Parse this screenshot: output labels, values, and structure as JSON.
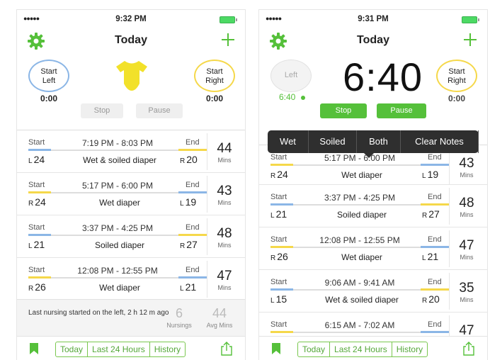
{
  "colors": {
    "accent": "#55c03a",
    "left_side": "#8bb6e6",
    "right_side": "#f5d84a",
    "onesie": "#f2e12a"
  },
  "left_screen": {
    "status": {
      "time": "9:32 PM"
    },
    "nav": {
      "title": "Today"
    },
    "start_left": {
      "label_1": "Start",
      "label_2": "Left",
      "time": "0:00"
    },
    "start_right": {
      "label_1": "Start",
      "label_2": "Right",
      "time": "0:00"
    },
    "stop_label": "Stop",
    "pause_label": "Pause",
    "entries": [
      {
        "start": "Start",
        "end": "End",
        "range": "7:19 PM - 8:03 PM",
        "a_side": "L",
        "a_val": "24",
        "desc": "Wet & soiled diaper",
        "b_side": "R",
        "b_val": "20",
        "mins": "44",
        "mins_label": "Mins"
      },
      {
        "start": "Start",
        "end": "End",
        "range": "5:17 PM - 6:00 PM",
        "a_side": "R",
        "a_val": "24",
        "desc": "Wet diaper",
        "b_side": "L",
        "b_val": "19",
        "mins": "43",
        "mins_label": "Mins"
      },
      {
        "start": "Start",
        "end": "End",
        "range": "3:37 PM - 4:25 PM",
        "a_side": "L",
        "a_val": "21",
        "desc": "Soiled diaper",
        "b_side": "R",
        "b_val": "27",
        "mins": "48",
        "mins_label": "Mins"
      },
      {
        "start": "Start",
        "end": "End",
        "range": "12:08 PM - 12:55 PM",
        "a_side": "R",
        "a_val": "26",
        "desc": "Wet diaper",
        "b_side": "L",
        "b_val": "21",
        "mins": "47",
        "mins_label": "Mins"
      }
    ],
    "summary": {
      "text": "Last nursing started on the left, 2 h 12 m ago",
      "nursings_value": "6",
      "nursings_label": "Nursings",
      "avg_value": "44",
      "avg_label": "Avg Mins"
    },
    "toolbar": {
      "today": "Today",
      "last24": "Last 24 Hours",
      "history": "History"
    }
  },
  "right_screen": {
    "status": {
      "time": "9:31 PM"
    },
    "nav": {
      "title": "Today"
    },
    "left_circle": {
      "label": "Left",
      "elapsed": "6:40"
    },
    "timer": "6:40",
    "start_right": {
      "label_1": "Start",
      "label_2": "Right",
      "time": "0:00"
    },
    "stop_label": "Stop",
    "pause_label": "Pause",
    "popover": [
      "Wet",
      "Soiled",
      "Both",
      "Clear Notes"
    ],
    "entries": [
      {
        "start": "Start",
        "end": "End",
        "range": "5:17 PM - 6:00 PM",
        "a_side": "R",
        "a_val": "24",
        "desc": "Wet diaper",
        "b_side": "L",
        "b_val": "19",
        "mins": "43",
        "mins_label": "Mins"
      },
      {
        "start": "Start",
        "end": "End",
        "range": "3:37 PM - 4:25 PM",
        "a_side": "L",
        "a_val": "21",
        "desc": "Soiled diaper",
        "b_side": "R",
        "b_val": "27",
        "mins": "48",
        "mins_label": "Mins"
      },
      {
        "start": "Start",
        "end": "End",
        "range": "12:08 PM - 12:55 PM",
        "a_side": "R",
        "a_val": "26",
        "desc": "Wet diaper",
        "b_side": "L",
        "b_val": "21",
        "mins": "47",
        "mins_label": "Mins"
      },
      {
        "start": "Start",
        "end": "End",
        "range": "9:06 AM - 9:41 AM",
        "a_side": "L",
        "a_val": "15",
        "desc": "Wet & soiled diaper",
        "b_side": "R",
        "b_val": "20",
        "mins": "35",
        "mins_label": "Mins"
      },
      {
        "start": "Start",
        "end": "End",
        "range": "6:15 AM - 7:02 AM",
        "a_side": "",
        "a_val": "",
        "desc": "",
        "b_side": "",
        "b_val": "",
        "mins": "47",
        "mins_label": ""
      }
    ],
    "toolbar": {
      "today": "Today",
      "last24": "Last 24 Hours",
      "history": "History"
    }
  }
}
